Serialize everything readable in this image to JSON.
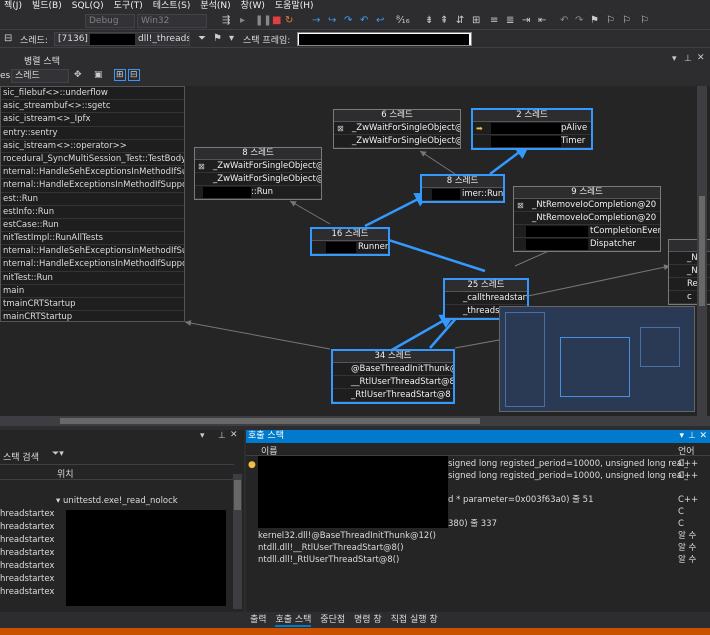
{
  "menu": {
    "items": [
      "젝(J)",
      "빌드(B)",
      "SQL(Q)",
      "도구(T)",
      "테스트(S)",
      "분석(N)",
      "창(W)",
      "도움말(H)"
    ]
  },
  "toolbar": {
    "config": "Debug",
    "platform": "Win32"
  },
  "threadbar": {
    "process_value": "[7136]",
    "thread_label": "스레드:",
    "thread_value": "dll!_threadst",
    "frame_label": "스택 프레임:"
  },
  "parallel_stacks": {
    "title": "병렬 스택",
    "view_label": "es",
    "view_select": "스레드",
    "frames": [
      "sic_filebuf<>::underflow",
      "asic_streambuf<>::sgetc",
      "asic_istream<>_Ipfx",
      "entry::sentry",
      "asic_istream<>::operator>>",
      "rocedural_SyncMultiSession_Test::TestBody",
      "nternal::HandleSehExceptionsInMethodIfSupporte...",
      "nternal::HandleExceptionsInMethodIfSupporte...",
      "est::Run",
      "estInfo::Run",
      "estCase::Run",
      "nitTestImpl::RunAllTests",
      "nternal::HandleSehExceptionsInMethodIfSupporte...",
      "nternal::HandleExceptionsInMethodIfSupporte...",
      "nitTest::Run",
      "main",
      "tmainCRTStartup",
      "mainCRTStartup"
    ],
    "nodes": {
      "n6": {
        "header": "6 스레드",
        "rows": [
          "_ZwWaitForSingleObject@12",
          "_ZwWaitForSingleObject@12"
        ]
      },
      "n2": {
        "header": "2 스레드",
        "rows": [
          "pAlive",
          "Timer"
        ]
      },
      "n8a": {
        "header": "8 스레드",
        "rows": [
          "_ZwWaitForSingleObject@12",
          "_ZwWaitForSingleObject@12",
          "::Run"
        ]
      },
      "n8b": {
        "header": "8 스레드",
        "rows": [
          "imer::Run"
        ]
      },
      "n9": {
        "header": "9 스레드",
        "rows": [
          "_NtRemoveIoCompletion@20",
          "_NtRemoveIoCompletion@20",
          "tCompletionEvent",
          "Dispatcher"
        ]
      },
      "n16": {
        "header": "16 스레드",
        "rows": [
          "Runner"
        ]
      },
      "n25": {
        "header": "25 스레드",
        "rows": [
          "_callthreadstartex",
          "_threadsta"
        ]
      },
      "n34": {
        "header": "34 스레드",
        "rows": [
          "@BaseThreadInitThunk@12",
          "__RtlUserThreadStart@8",
          "_RtlUserThreadStart@8"
        ]
      },
      "nR": {
        "rows": [
          "_N",
          "_N",
          "Re",
          "c"
        ]
      }
    }
  },
  "threads_panel": {
    "search_label": "스택 검색",
    "column_location": "위치",
    "rows": [
      "unittestd.exe!_read_nolock",
      "hreadstartex",
      "hreadstartex",
      "hreadstartex",
      "hreadstartex",
      "hreadstartex",
      "hreadstartex",
      "hreadstartex"
    ]
  },
  "call_stack": {
    "title": "호출 스택",
    "col_name": "이름",
    "col_lang": "언어",
    "rows": [
      {
        "name": "signed long registed_period=10000, unsigned long real_elaps",
        "lang": "C++"
      },
      {
        "name": "signed long registed_period=10000, unsigned long real_elaps",
        "lang": "C++"
      },
      {
        "name": "d * parameter=0x003f63a0) 줄 51",
        "lang": "C++"
      },
      {
        "name": "",
        "lang": "C"
      },
      {
        "name": "380) 줄 337",
        "lang": "C"
      },
      {
        "name": "kernel32.dll!@BaseThreadInitThunk@12()",
        "lang": "알 수"
      },
      {
        "name": "ntdll.dll!__RtlUserThreadStart@8()",
        "lang": "알 수"
      },
      {
        "name": "ntdll.dll!_RtlUserThreadStart@8()",
        "lang": "알 수"
      }
    ]
  },
  "bottom_tabs": [
    "출력",
    "호출 스택",
    "중단점",
    "명령 창",
    "직접 실행 창"
  ]
}
